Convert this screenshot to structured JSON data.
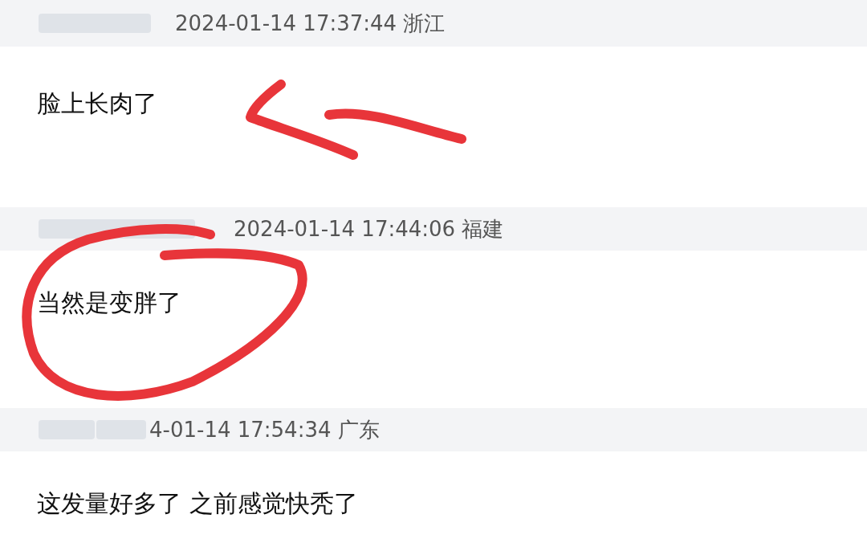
{
  "comments": [
    {
      "time": "2024-01-14 17:37:44 浙江",
      "text": "脸上长肉了",
      "annotation": {
        "kind": "arrow",
        "color": "#e8353a"
      }
    },
    {
      "time": "2024-01-14 17:44:06 福建",
      "text": "当然是变胖了",
      "annotation": {
        "kind": "circle",
        "color": "#e8353a"
      }
    },
    {
      "time": "4-01-14 17:54:34 广东",
      "text": "这发量好多了 之前感觉快秃了"
    }
  ]
}
